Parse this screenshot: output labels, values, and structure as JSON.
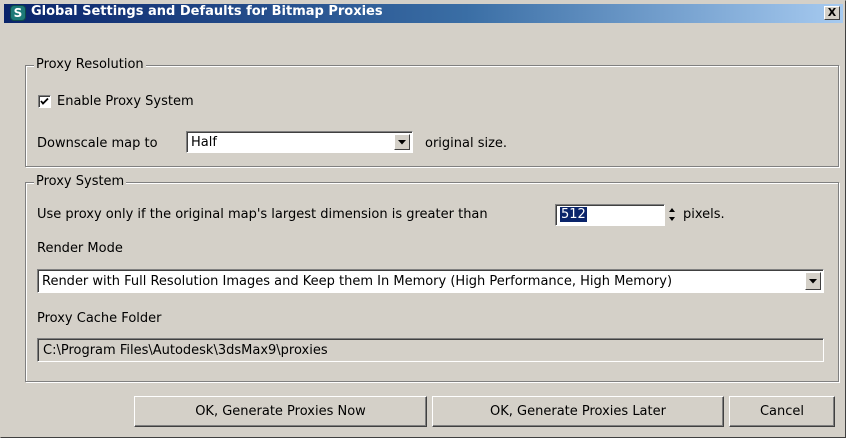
{
  "window": {
    "title": "Global Settings and Defaults for Bitmap Proxies",
    "app_icon_glyph": "S",
    "close_glyph": "X"
  },
  "proxy_resolution": {
    "legend": "Proxy Resolution",
    "enable_label": "Enable Proxy System",
    "enable_checked": true,
    "downscale_prefix": "Downscale map to",
    "downscale_value": "Half",
    "downscale_suffix": "original size."
  },
  "proxy_system": {
    "legend": "Proxy System",
    "threshold_prefix": "Use proxy only if the original map's largest dimension is greater than",
    "threshold_value": "512",
    "threshold_suffix": "pixels.",
    "render_mode_label": "Render Mode",
    "render_mode_value": "Render with Full Resolution Images and Keep them In Memory (High Performance, High Memory)",
    "cache_folder_label": "Proxy Cache Folder",
    "cache_folder_value": "C:\\Program Files\\Autodesk\\3dsMax9\\proxies"
  },
  "buttons": {
    "generate_now": "OK, Generate Proxies Now",
    "generate_later": "OK, Generate Proxies Later",
    "cancel": "Cancel"
  },
  "icons": {
    "app": "3ds-max-icon",
    "close": "close-icon",
    "check": "checkmark-icon",
    "dropdown": "chevron-down-icon",
    "spinner_up": "spinner-up-icon",
    "spinner_down": "spinner-down-icon"
  },
  "colors": {
    "title_start": "#0a246a",
    "title_end": "#a6caf0",
    "dialog_face": "#d4d0c8",
    "selection": "#0a246a"
  }
}
